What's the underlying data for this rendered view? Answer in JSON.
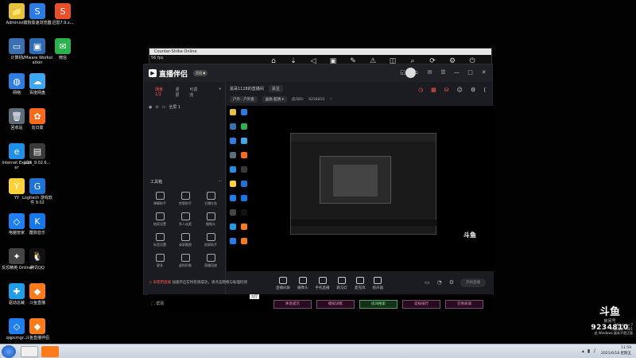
{
  "desktop": {
    "icons": [
      {
        "label": "Administ...",
        "color": "#e7c23a",
        "glyph": "📁"
      },
      {
        "label": "搜狗高速浏览器",
        "color": "#2c7be5",
        "glyph": "S"
      },
      {
        "label": "迅雷7.9.x...",
        "color": "#e84f2a",
        "glyph": "S"
      },
      {
        "label": "计算机",
        "color": "#3a6fb0",
        "glyph": "▭"
      },
      {
        "label": "VMware Workstation",
        "color": "#2f6bb2",
        "glyph": "▣"
      },
      {
        "label": "微信",
        "color": "#2bb24c",
        "glyph": "✉"
      },
      {
        "label": "网络",
        "color": "#2f7de0",
        "glyph": "◍"
      },
      {
        "label": "百度网盘",
        "color": "#3fa7f0",
        "glyph": "☁"
      },
      {
        "label": "回收站",
        "color": "#5c6c7a",
        "glyph": "🗑"
      },
      {
        "label": "向日葵",
        "color": "#ff6a1a",
        "glyph": "✿"
      },
      {
        "label": "Internet Explorer",
        "color": "#1f8fe8",
        "glyph": "e"
      },
      {
        "label": "LGS_9.02.6...",
        "color": "#3a3a3a",
        "glyph": "▤"
      },
      {
        "label": "YY",
        "color": "#ffd23a",
        "glyph": "Y"
      },
      {
        "label": "Logitech 游戏软件 9.02",
        "color": "#1d73d6",
        "glyph": "G"
      },
      {
        "label": "电脑管家",
        "color": "#1f7ef0",
        "glyph": "◇"
      },
      {
        "label": "酷狗音乐",
        "color": "#1677e8",
        "glyph": "K"
      },
      {
        "label": "反恐精英 Online",
        "color": "#444",
        "glyph": "✦"
      },
      {
        "label": "腾讯QQ",
        "color": "#111",
        "glyph": "🐧"
      },
      {
        "label": "驱动总裁",
        "color": "#1f9de8",
        "glyph": "✚"
      },
      {
        "label": "斗鱼直播",
        "color": "#ff7a1a",
        "glyph": "◆"
      },
      {
        "label": "qqpcmgr...",
        "color": "#1f7ef0",
        "glyph": "◇"
      },
      {
        "label": "斗鱼直播伴侣",
        "color": "#ff7a1a",
        "glyph": "◆"
      }
    ]
  },
  "cs_window": {
    "title": "Counter-Strike Online",
    "fps": "56 fps",
    "toolbar": [
      "⌂",
      "⇣",
      "◁",
      "▣",
      "✎",
      "⚠",
      "◫",
      "⌕",
      "⟳",
      "⚙",
      "⏻"
    ]
  },
  "app": {
    "name": "直播伴侣",
    "badge": "活动 ◆",
    "header_buttons": [
      "◱",
      "⌂",
      "✉",
      "☰",
      "—",
      "□",
      "✕"
    ],
    "scene_tabs": [
      "场景1/2",
      "竖屏",
      "可调流"
    ],
    "scene_add": "+",
    "scene_item": "全屏 1",
    "tools_title": "工具箱",
    "tools_more": "···",
    "tools": [
      "弹幕助手",
      "房管助手",
      "主播任务",
      "抽奖设置",
      "多人连麦",
      "摄像头",
      "标签设置",
      "录屏截图",
      "投屏助手",
      "更多",
      "虚拟形象",
      "直播回放"
    ],
    "notice_warn": "⚠ 未使用直播",
    "notice_text": "加速开启实时检测成功，请点击网络与助理检测",
    "room_title": "黑哥1128的直播间",
    "follow": "关注",
    "category": "户外 · 户外类",
    "quality": "画质·超清 ▾",
    "room_id_label": "房间ID:",
    "room_id": "9234810",
    "top_tools": [
      "◷",
      "▦",
      "⛁",
      "☺",
      "⚙",
      "⟨"
    ],
    "bottom_tools": [
      "直播间屏",
      "摄像头",
      "手机直播",
      "跑马灯",
      "麦克风",
      "扬声器"
    ],
    "bottom_icons": [
      "▭",
      "◔",
      "⚙"
    ],
    "go_live": "开始直播",
    "douyu_mark": "斗鱼"
  },
  "hud": {
    "help": "⬚ 帮助",
    "buttons": [
      "休息提示",
      "模拟训练",
      "房间搜索",
      "竞技排行",
      "交易商城"
    ],
    "tag": "大厅"
  },
  "overlay": {
    "brand": "斗鱼",
    "room_label": "房间号",
    "room_id": "9234810"
  },
  "taskbar": {
    "time": "11:59",
    "date": "2021/6/18 星期五",
    "os_line1": "Windows 7",
    "os_line2": "内部版本 7601",
    "os_line3": "此 Windows 副本不是正版"
  }
}
